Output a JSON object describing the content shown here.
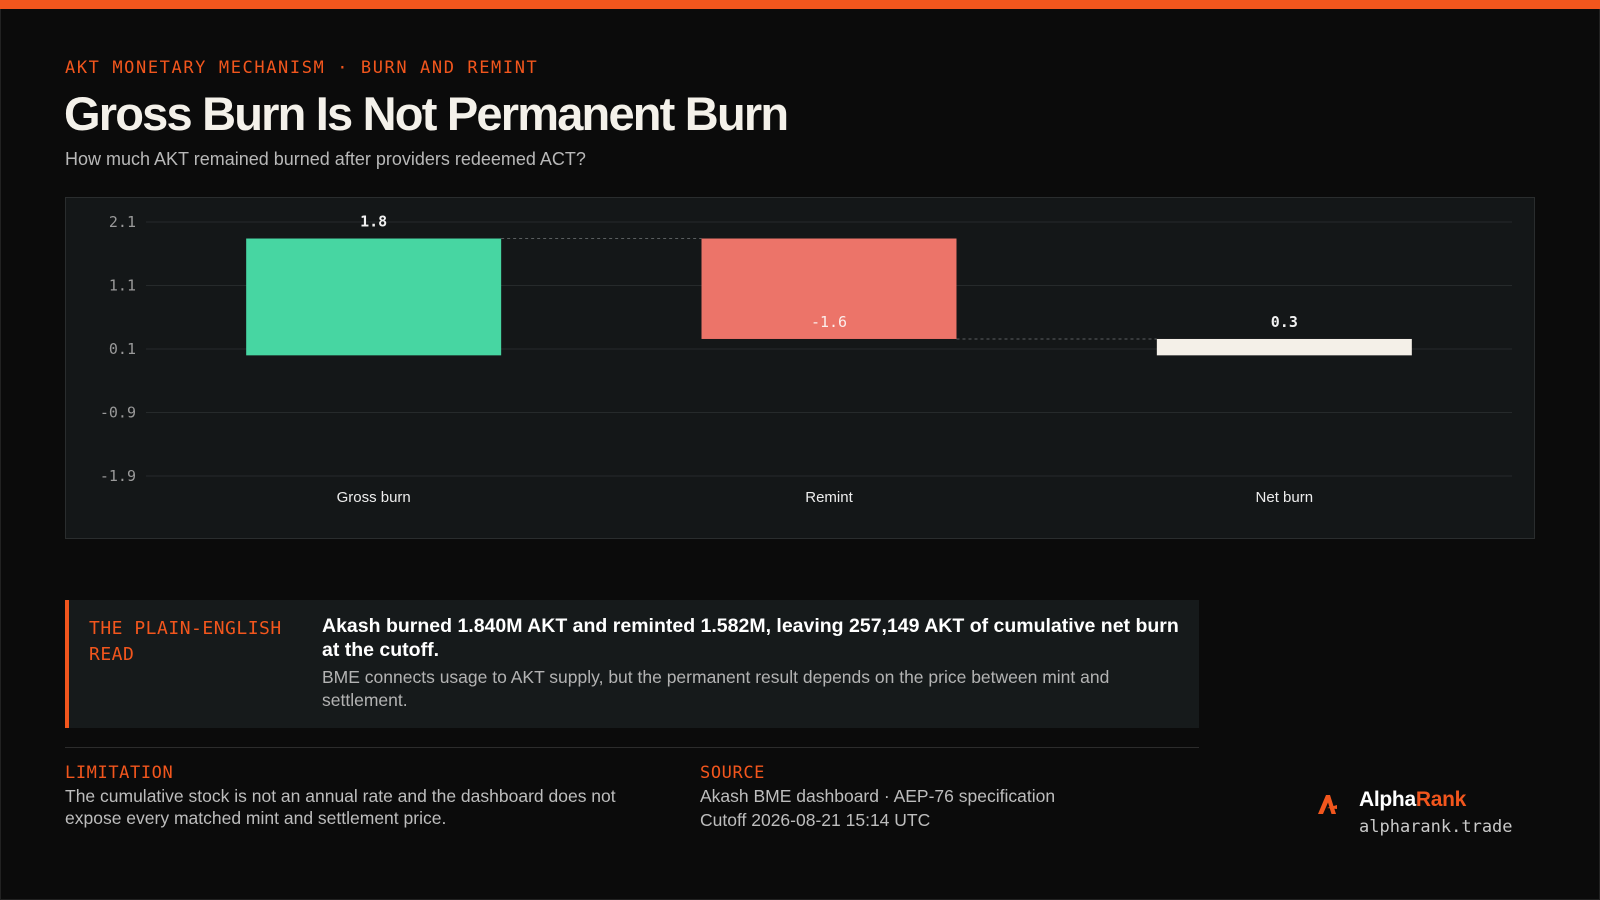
{
  "header": {
    "kicker": "AKT MONETARY MECHANISM · BURN AND REMINT",
    "title": "Gross Burn Is Not Permanent Burn",
    "subtitle": "How much AKT remained burned after providers redeemed ACT?"
  },
  "chart_data": {
    "type": "bar",
    "subtype": "waterfall",
    "title": "",
    "xlabel": "",
    "ylabel": "",
    "categories": [
      "Gross burn",
      "Remint",
      "Net burn"
    ],
    "values": [
      1.84,
      -1.582,
      0.257
    ],
    "value_labels": [
      "1.8",
      "-1.6",
      "0.3"
    ],
    "yticks": [
      2.1,
      1.1,
      0.1,
      -0.9,
      -1.9
    ],
    "ytick_labels": [
      "2.1",
      "1.1",
      "0.1",
      "-0.9",
      "-1.9"
    ],
    "ylim": [
      -1.9,
      2.1
    ],
    "grid": true,
    "legend": "none",
    "colors": {
      "gross": "#47d6a2",
      "remint": "#ec7469",
      "net": "#f4f0e8"
    }
  },
  "callout": {
    "label": "THE PLAIN-ENGLISH READ",
    "headline": "Akash burned 1.840M AKT and reminted 1.582M, leaving 257,149 AKT of cumulative net burn at the cutoff.",
    "body": "BME connects usage to AKT supply, but the permanent result depends on the price between mint and settlement."
  },
  "notes": {
    "limitation_label": "LIMITATION",
    "limitation_text": "The cumulative stock is not an annual rate and the dashboard does not expose every matched mint and settlement price.",
    "source_label": "SOURCE",
    "source_line1": "Akash BME dashboard · AEP-76 specification",
    "source_line2": "Cutoff 2026-08-21 15:14 UTC"
  },
  "brand": {
    "name_part1": "Alpha",
    "name_part2": "Rank",
    "url": "alpharank.trade",
    "icon": "alpharank-logo-icon",
    "accent": "#f2561d"
  }
}
